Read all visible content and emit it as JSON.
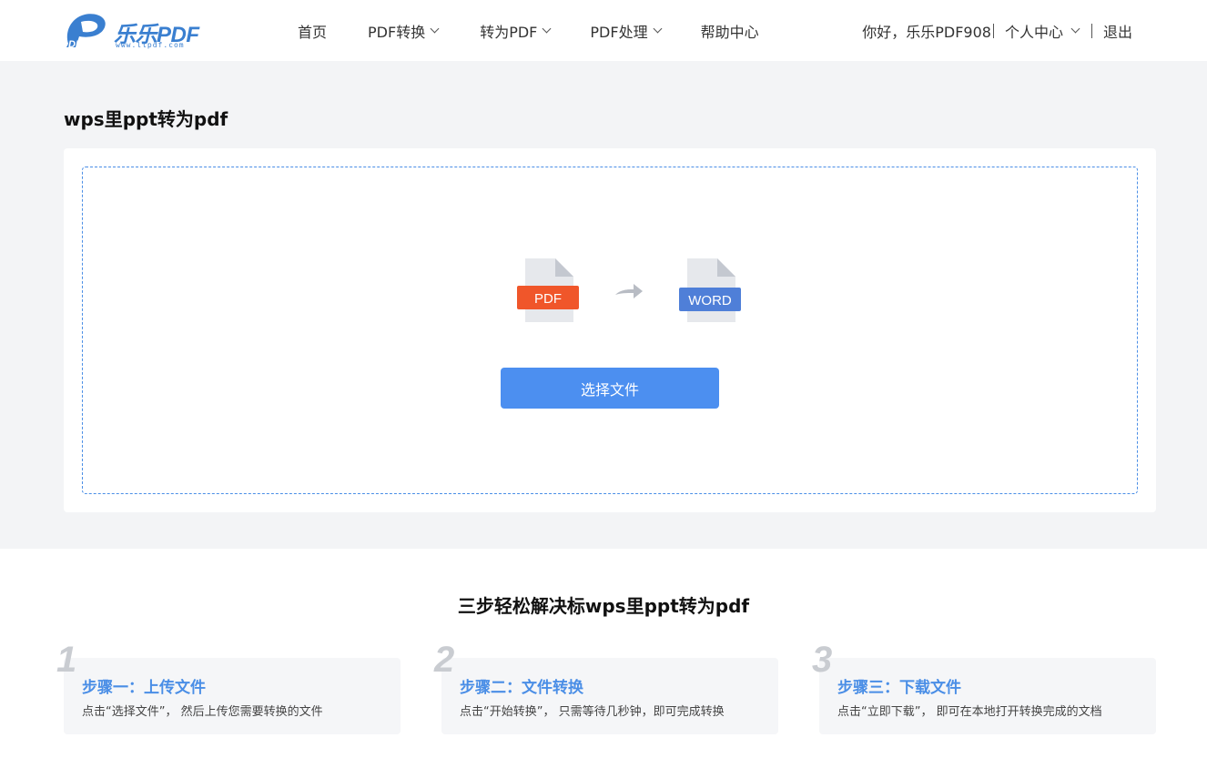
{
  "header": {
    "logo_text": "乐乐PDF",
    "logo_url": "www.llpdf.com",
    "nav": [
      {
        "label": "首页",
        "has_dropdown": false
      },
      {
        "label": "PDF转换",
        "has_dropdown": true
      },
      {
        "label": "转为PDF",
        "has_dropdown": true
      },
      {
        "label": "PDF处理",
        "has_dropdown": true
      },
      {
        "label": "帮助中心",
        "has_dropdown": false
      }
    ],
    "greeting": "你好，乐乐PDF908",
    "user_center": "个人中心",
    "logout": "退出"
  },
  "main": {
    "title": "wps里ppt转为pdf",
    "from_label": "PDF",
    "to_label": "WORD",
    "choose_button": "选择文件"
  },
  "steps": {
    "title": "三步轻松解决标wps里ppt转为pdf",
    "items": [
      {
        "num": "1",
        "title": "步骤一：上传文件",
        "desc": "点击“选择文件”， 然后上传您需要转换的文件"
      },
      {
        "num": "2",
        "title": "步骤二：文件转换",
        "desc": "点击“开始转换”， 只需等待几秒钟，即可完成转换"
      },
      {
        "num": "3",
        "title": "步骤三：下载文件",
        "desc": "点击“立即下载”， 即可在本地打开转换完成的文档"
      }
    ]
  },
  "colors": {
    "accent": "#4c8ff0",
    "pdf_red": "#f0562a",
    "word_blue": "#4f7fd8",
    "background": "#f3f4f6"
  }
}
